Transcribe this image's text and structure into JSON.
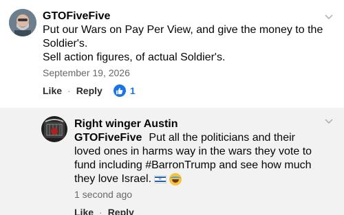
{
  "comments": [
    {
      "author": "GTOFiveFive",
      "text_lines": [
        "Put our Wars on Pay Per View, and give the money to the",
        "Soldier's.",
        "Sell action figures, of actual Soldier's."
      ],
      "timestamp": "September 19, 2026",
      "like_label": "Like",
      "reply_label": "Reply",
      "reaction_count": "1",
      "reaction_icon": "thumbs-up-icon"
    },
    {
      "author": "Right winger Austin",
      "mention": "GTOFiveFive",
      "text_lines": [
        "Put all the politicians  and their",
        "loved ones in harms way in the wars they vote to",
        "fund including #BarronTrump  and see how much",
        "they love Israel."
      ],
      "timestamp": "1 second ago",
      "like_label": "Like",
      "reply_label": "Reply",
      "emojis": [
        "israel-flag-icon",
        "laughing-tears-emoji"
      ]
    }
  ],
  "colors": {
    "reply_background": "#f2f2f2",
    "accent_blue": "#1b74e4",
    "secondary_text": "#65676b"
  }
}
